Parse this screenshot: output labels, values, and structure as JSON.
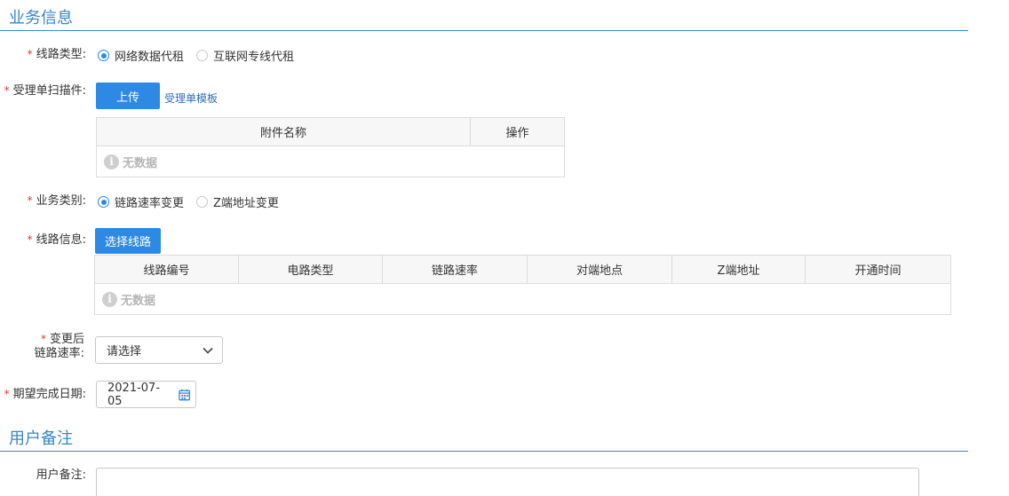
{
  "sections": {
    "business_info": "业务信息",
    "user_remark": "用户备注"
  },
  "required_mark": "*",
  "line_type": {
    "label": "线路类型:",
    "options": [
      "网络数据代租",
      "互联网专线代租"
    ],
    "selected": 0
  },
  "scan": {
    "label": "受理单扫描件:",
    "upload_label": "上传",
    "template_link": "受理单模板",
    "table": {
      "headers": [
        "附件名称",
        "操作"
      ],
      "empty_text": "无数据"
    }
  },
  "business_type": {
    "label": "业务类别:",
    "options": [
      "链路速率变更",
      "Z端地址变更"
    ],
    "selected": 0
  },
  "line_info": {
    "label": "线路信息:",
    "select_label": "选择线路",
    "table": {
      "headers": [
        "线路编号",
        "电路类型",
        "链路速率",
        "对端地点",
        "Z端地址",
        "开通时间"
      ],
      "empty_text": "无数据"
    }
  },
  "new_rate": {
    "label_line1": "变更后",
    "label_line2": "链路速率:",
    "value": "请选择"
  },
  "expected_date": {
    "label": "期望完成日期:",
    "value": "2021-07-05"
  },
  "remark": {
    "label": "用户备注:",
    "value": ""
  },
  "colors": {
    "accent": "#2d89e3",
    "title": "#3a85c8",
    "required": "#e53935"
  },
  "icons": {
    "info": "i"
  }
}
